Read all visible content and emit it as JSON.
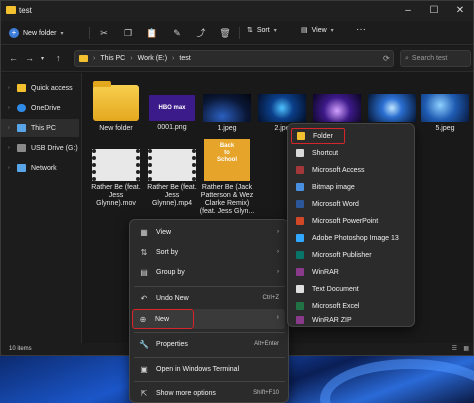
{
  "window": {
    "title": "test"
  },
  "toolbar": {
    "new_label": "New folder",
    "sort_label": "Sort",
    "view_label": "View",
    "more": "···"
  },
  "nav": {
    "path": [
      "This PC",
      "Work (E:)",
      "test"
    ],
    "search_placeholder": "Search test"
  },
  "sidebar": {
    "items": [
      {
        "label": "Quick access",
        "color": "#f3c02f"
      },
      {
        "label": "OneDrive",
        "color": "#2f8be6"
      },
      {
        "label": "This PC",
        "color": "#5aa4e8"
      },
      {
        "label": "USB Drive (G:)",
        "color": "#8a8a8a"
      },
      {
        "label": "Network",
        "color": "#5aa4e8"
      }
    ]
  },
  "files": [
    {
      "name": "New folder",
      "kind": "folder"
    },
    {
      "name": "0001.png",
      "kind": "image"
    },
    {
      "name": "1.jpeg",
      "kind": "image"
    },
    {
      "name": "2.jpe",
      "kind": "image"
    },
    {
      "name": "",
      "kind": "image"
    },
    {
      "name": "",
      "kind": "image"
    },
    {
      "name": "5.jpeg",
      "kind": "image"
    },
    {
      "name": "Rather Be (feat. Jess Glynne).mov",
      "kind": "video"
    },
    {
      "name": "Rather Be (feat. Jess Glynne).mp4",
      "kind": "video"
    },
    {
      "name": "Rather Be (Jack Patterson & Wez Clarke Remix) (feat. Jess Glyn...",
      "kind": "image"
    }
  ],
  "thumb_text": {
    "hbomax": "HBO max",
    "back": "Back",
    "to": "to",
    "school": "School"
  },
  "status": {
    "count": "10 items"
  },
  "context_menu": {
    "items": [
      {
        "label": "View",
        "icon": "▦",
        "shortcut": "",
        "arrow": true
      },
      {
        "label": "Sort by",
        "icon": "⇅",
        "shortcut": "",
        "arrow": true
      },
      {
        "label": "Group by",
        "icon": "▤",
        "shortcut": "",
        "arrow": true
      },
      {
        "label": "Undo New",
        "icon": "↶",
        "shortcut": "Ctrl+Z",
        "arrow": false
      },
      {
        "label": "New",
        "icon": "⊕",
        "shortcut": "",
        "arrow": true
      },
      {
        "label": "Properties",
        "icon": "🔧",
        "shortcut": "Alt+Enter",
        "arrow": false
      },
      {
        "label": "Open in Windows Terminal",
        "icon": "▣",
        "shortcut": "",
        "arrow": false
      },
      {
        "label": "Show more options",
        "icon": "⇱",
        "shortcut": "Shift+F10",
        "arrow": false
      }
    ],
    "arrow_glyph": "›"
  },
  "new_submenu": {
    "items": [
      {
        "label": "Folder",
        "color": "#f3c02f"
      },
      {
        "label": "Shortcut",
        "color": "#d8d8d8"
      },
      {
        "label": "Microsoft Access",
        "color": "#a4373a"
      },
      {
        "label": "Bitmap image",
        "color": "#4a90e2"
      },
      {
        "label": "Microsoft Word",
        "color": "#2b579a"
      },
      {
        "label": "Microsoft PowerPoint",
        "color": "#d24726"
      },
      {
        "label": "Adobe Photoshop Image 13",
        "color": "#31a8ff"
      },
      {
        "label": "Microsoft Publisher",
        "color": "#077568"
      },
      {
        "label": "WinRAR",
        "color": "#8b3a8b"
      },
      {
        "label": "Text Document",
        "color": "#e0e0e0"
      },
      {
        "label": "Microsoft Excel",
        "color": "#217346"
      },
      {
        "label": "WinRAR ZIP",
        "color": "#8b3a8b"
      }
    ]
  }
}
